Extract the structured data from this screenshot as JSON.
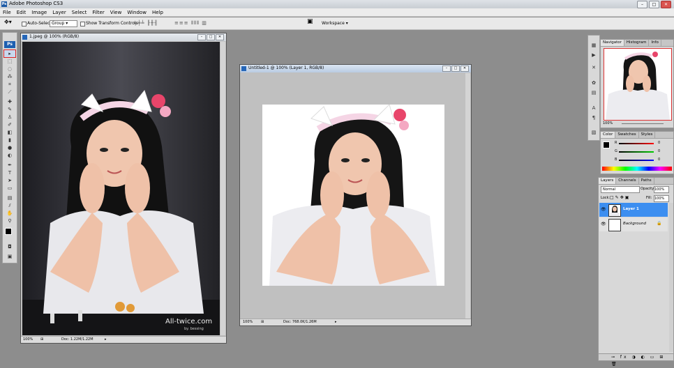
{
  "app": {
    "title": "Adobe Photoshop CS3",
    "logo": "Ps"
  },
  "menu": [
    "File",
    "Edit",
    "Image",
    "Layer",
    "Select",
    "Filter",
    "View",
    "Window",
    "Help"
  ],
  "options": {
    "auto_select_label": "Auto-Select:",
    "auto_select_value": "Group",
    "show_transform_label": "Show Transform Controls",
    "workspace_label": "Workspace ▾"
  },
  "doc1": {
    "title": "1.jpeg @ 100% (RGB/8)",
    "zoom": "100%",
    "docsize": "Doc: 1.22M/1.22M",
    "watermark1": "All-twice.com",
    "watermark2": "by. bessing"
  },
  "doc2": {
    "title": "Untitled-1 @ 100% (Layer 1, RGB/8)",
    "zoom": "100%",
    "docsize": "Doc: 768.0K/1.26M"
  },
  "navigator": {
    "tabs": [
      "Navigator",
      "Histogram",
      "Info"
    ],
    "zoom": "100%"
  },
  "color": {
    "tabs": [
      "Color",
      "Swatches",
      "Styles"
    ],
    "channels": [
      {
        "name": "R",
        "value": "0"
      },
      {
        "name": "G",
        "value": "0"
      },
      {
        "name": "B",
        "value": "0"
      }
    ]
  },
  "layers": {
    "tabs": [
      "Layers",
      "Channels",
      "Paths"
    ],
    "blend": "Normal",
    "opacity_label": "Opacity:",
    "opacity": "100%",
    "lock_label": "Lock:",
    "fill_label": "Fill:",
    "fill": "100%",
    "items": [
      {
        "name": "Layer 1",
        "selected": true
      },
      {
        "name": "Background",
        "selected": false
      }
    ]
  },
  "colors": {
    "accent": "#3b8fe0",
    "selection": "#3c8ef0"
  }
}
